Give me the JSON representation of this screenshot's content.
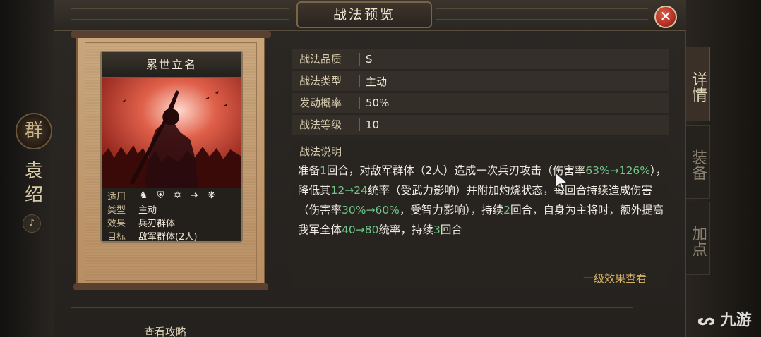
{
  "header": {
    "title": "战法预览"
  },
  "left_banner": {
    "faction": "群",
    "hero_name_1": "袁",
    "hero_name_2": "绍"
  },
  "side_tabs": [
    {
      "label": "详情",
      "active": true
    },
    {
      "label": "装备",
      "active": false
    },
    {
      "label": "加点",
      "active": false
    }
  ],
  "card": {
    "name": "累世立名",
    "meta": [
      {
        "key": "适用",
        "value": ""
      },
      {
        "key": "类型",
        "value": "主动"
      },
      {
        "key": "效果",
        "value": "兵刃群体"
      },
      {
        "key": "目标",
        "value": "敌军群体(2人)"
      }
    ],
    "applies_icons": [
      "cavalry-icon",
      "shield-icon",
      "bow-icon",
      "spear-icon",
      "wheel-icon"
    ]
  },
  "info": [
    {
      "key": "战法品质",
      "value": "S"
    },
    {
      "key": "战法类型",
      "value": "主动"
    },
    {
      "key": "发动概率",
      "value": "50%"
    },
    {
      "key": "战法等级",
      "value": "10"
    }
  ],
  "description": {
    "label": "战法说明",
    "segments": [
      {
        "t": "准备",
        "c": ""
      },
      {
        "t": "1",
        "c": "green"
      },
      {
        "t": "回合，对敌军群体（2人）造成一次兵刃攻击（伤害率",
        "c": ""
      },
      {
        "t": "63%→126%",
        "c": "green"
      },
      {
        "t": "），降低其",
        "c": ""
      },
      {
        "t": "12→24",
        "c": "green"
      },
      {
        "t": "统率（受武力影响）并附加灼烧状态，每回合持续造成伤害（伤害率",
        "c": ""
      },
      {
        "t": "30%→60%",
        "c": "green"
      },
      {
        "t": "，受智力影响），持续",
        "c": ""
      },
      {
        "t": "2",
        "c": "green"
      },
      {
        "t": "回合，自身为主将时，额外提高我军全体",
        "c": ""
      },
      {
        "t": "40→80",
        "c": "green"
      },
      {
        "t": "统率，持续",
        "c": ""
      },
      {
        "t": "3",
        "c": "green"
      },
      {
        "t": "回合",
        "c": ""
      }
    ]
  },
  "links": {
    "detail": "一级效果查看",
    "guide": "查看攻略"
  },
  "watermark": "九游"
}
